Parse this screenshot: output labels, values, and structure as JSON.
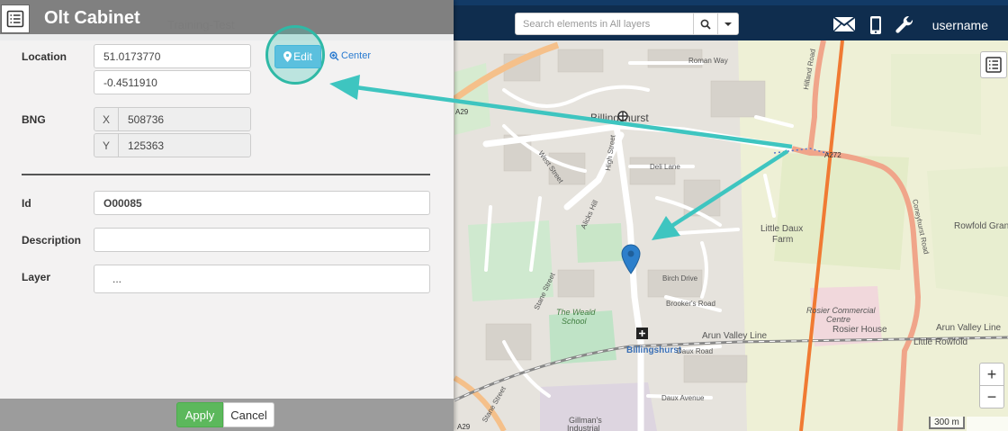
{
  "topbar": {
    "search_placeholder": "Search elements in All layers",
    "mail_icon": "envelope-icon",
    "phone_icon": "mobile-phone-icon",
    "tools_icon": "wrench-icon",
    "username": "username"
  },
  "panel": {
    "title": "Olt Cabinet",
    "watermark": "Training-Test",
    "location": {
      "label": "Location",
      "latitude": "51.0173770",
      "longitude": "-0.4511910",
      "edit_label": "Edit",
      "center_label": "Center"
    },
    "bng": {
      "label": "BNG",
      "x_addon": "X",
      "x_value": "508736",
      "y_addon": "Y",
      "y_value": "125363"
    },
    "id": {
      "label": "Id",
      "value": "O00085"
    },
    "description": {
      "label": "Description",
      "value": ""
    },
    "layer": {
      "label": "Layer",
      "value": "..."
    },
    "apply_label": "Apply",
    "cancel_label": "Cancel"
  },
  "map": {
    "labels": {
      "billingshurst_top": "Billingshurst",
      "billingshurst_station": "Billingshurst",
      "little_daux": "Little Daux",
      "farm": "Farm",
      "rowfold_grange": "Rowfold Grange",
      "rosier_commercial": "Rosier Commercial",
      "centre": "Centre",
      "rosier_house": "Rosier House",
      "little_rowfold": "Little Rowfold",
      "weald_school": "The Weald",
      "school": "School",
      "gillmans": "Gillman's",
      "industrial": "Industrial",
      "arun_valley_line": "Arun Valley Line",
      "arun_valley_line_2": "Arun Valley Line",
      "high_street": "High Street",
      "west_street": "West Street",
      "coneyhurst_road": "Coneyhurst Road",
      "hilland_road": "Hilland Road",
      "brookers_road": "Brooker's Road",
      "daux_road": "Daux Road",
      "daux_avenue": "Daux Avenue",
      "roman_way": "Roman Way",
      "deli_lane": "Deli Lane",
      "birch_drive": "Birch Drive",
      "a29": "A29",
      "a29_bottom": "A29",
      "a272": "A272",
      "stane_street": "Stane Street",
      "stane_street_2": "Stane Street",
      "alicks_hill": "Alicks Hill"
    },
    "scale_label": "300 m",
    "zoom_in": "+",
    "zoom_out": "−"
  },
  "colors": {
    "topbar": "#0f2d4e",
    "edit_button": "#5bc0de",
    "apply_button": "#5cb85c",
    "annotation_teal": "#3ec5c0",
    "marker": "#2c7fcb",
    "rail_orange": "#f07a33"
  }
}
